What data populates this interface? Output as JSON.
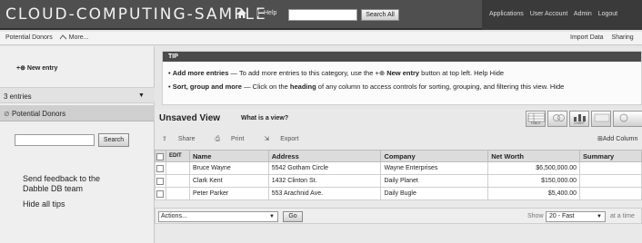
{
  "header": {
    "app_title": "CLOUD-COMPUTING-SAMPLE",
    "help": "Help",
    "search_button": "Search All",
    "nav": [
      "Applications",
      "User Account",
      "Admin",
      "Logout"
    ]
  },
  "subbar": {
    "breadcrumb": "Potential Donors",
    "more": "More...",
    "import": "Import Data",
    "sharing": "Sharing"
  },
  "sidebar": {
    "new_entry": "New entry",
    "entries_count": "3 entries",
    "view_name": "Potential Donors",
    "search_button": "Search",
    "feedback": "Send feedback to the Dabble DB team",
    "hide_all_tips": "Hide all tips"
  },
  "tip": {
    "title": "TIP",
    "line1_bold": "Add more entries",
    "line1_text": " — To add more entries to this category, use the ",
    "line1_bold2": "New entry",
    "line1_text2": " button at top left.",
    "line1_help": "Help",
    "line1_hide": "Hide",
    "line2_bold": "Sort, group and more",
    "line2_text": " — Click on the ",
    "line2_bold2": "heading",
    "line2_text2": " of any column to access controls for sorting, grouping, and filtering this view.",
    "line2_hide": "Hide"
  },
  "view": {
    "title": "Unsaved View",
    "what_is": "What is a view?",
    "icons": [
      {
        "name": "table-view-icon",
        "label": "TABLE"
      },
      {
        "name": "calendar-view-icon",
        "label": ""
      },
      {
        "name": "chart-view-icon",
        "label": "CHART"
      },
      {
        "name": "map-view-icon",
        "label": ""
      },
      {
        "name": "more-view-icon",
        "label": ""
      }
    ],
    "toolbar": [
      "Share",
      "Print",
      "Export"
    ],
    "add_column": "Add Column"
  },
  "table": {
    "columns": [
      "EDIT",
      "Name",
      "Address",
      "Company",
      "Net Worth",
      "Summary"
    ],
    "rows": [
      [
        "Bruce Wayne",
        "5542 Gotham Circle",
        "Wayne Enterprises",
        "$6,500,000.00",
        ""
      ],
      [
        "Clark Kent",
        "1432 Clinton St.",
        "Daily Planet",
        "$150,000.00",
        ""
      ],
      [
        "Peter Parker",
        "553 Arachnid Ave.",
        "Daily Bugle",
        "$5,400.00",
        ""
      ]
    ]
  },
  "footer": {
    "actions": "Actions...",
    "go": "Go",
    "show": "Show",
    "page_size": "20 - Fast",
    "at_a_time": "at a time"
  }
}
